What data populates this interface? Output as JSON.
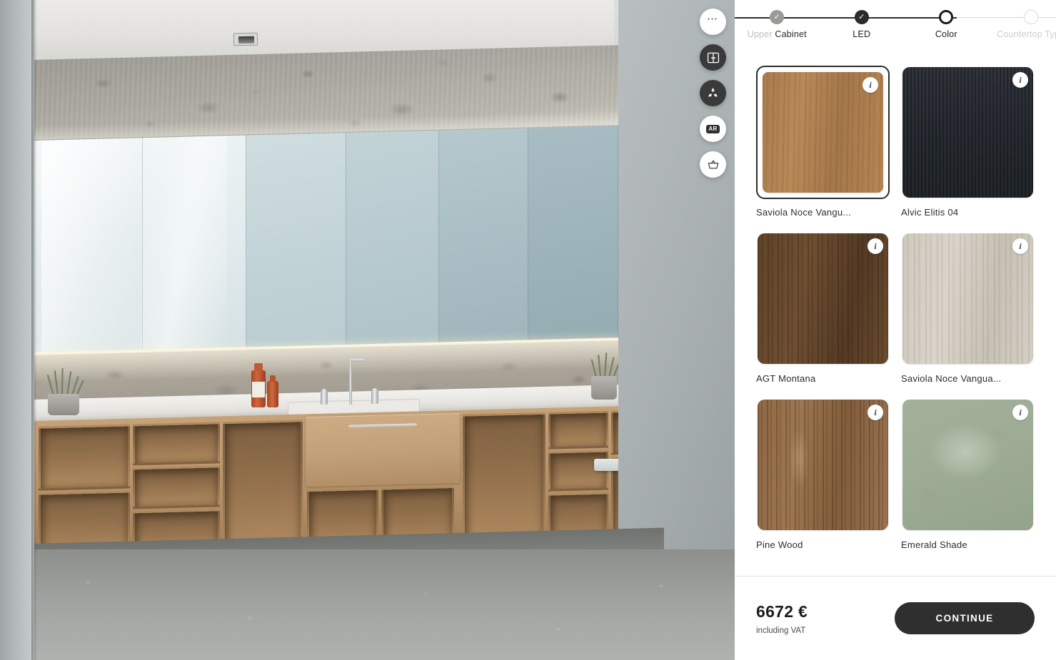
{
  "viewport": {
    "scene_name": "bathroom-vanity-render",
    "toolbar": [
      {
        "icon": "more-options-icon",
        "label": "More options",
        "style": "light"
      },
      {
        "icon": "cabinet-layout-icon",
        "label": "Cabinet layout",
        "style": "dark"
      },
      {
        "icon": "sustainability-icon",
        "label": "Sustainability",
        "style": "dark"
      },
      {
        "icon": "ar-icon",
        "label": "AR",
        "style": "light"
      },
      {
        "icon": "basket-icon",
        "label": "Basket",
        "style": "light"
      }
    ]
  },
  "stepper": {
    "steps": [
      {
        "label": "Upper Cabinet",
        "label_part_a": "Upper ",
        "label_part_b": "Cabinet",
        "state": "completed-gray",
        "icon": "check-icon"
      },
      {
        "label": "LED",
        "state": "completed",
        "icon": "check-icon"
      },
      {
        "label": "Color",
        "state": "current",
        "icon": ""
      },
      {
        "label": "Countertop Type",
        "state": "upcoming",
        "icon": ""
      }
    ]
  },
  "swatches": [
    {
      "name": "Saviola Noce Vangu...",
      "texture": "tex-saviola-noce",
      "selected": true,
      "info": "i"
    },
    {
      "name": "Alvic Elitis 04",
      "texture": "tex-alvic-elitis",
      "selected": false,
      "info": "i"
    },
    {
      "name": "AGT Montana",
      "texture": "tex-agt-montana",
      "selected": false,
      "info": "i"
    },
    {
      "name": "Saviola Noce Vangua...",
      "texture": "tex-saviola-light",
      "selected": false,
      "info": "i"
    },
    {
      "name": "Pine Wood",
      "texture": "tex-pine",
      "selected": false,
      "info": "i"
    },
    {
      "name": "Emerald Shade",
      "texture": "tex-emerald",
      "selected": false,
      "info": "i"
    }
  ],
  "footer": {
    "price": "6672 €",
    "vat_note": "including VAT",
    "continue_label": "CONTINUE"
  },
  "colors": {
    "accent_dark": "#2f2f2f",
    "step_done_gray": "#9b9a97",
    "step_done_dark": "#2b2b2b",
    "panel_bg": "#ffffff",
    "text_primary": "#1d1d1d",
    "text_muted": "#b9b7b4"
  }
}
